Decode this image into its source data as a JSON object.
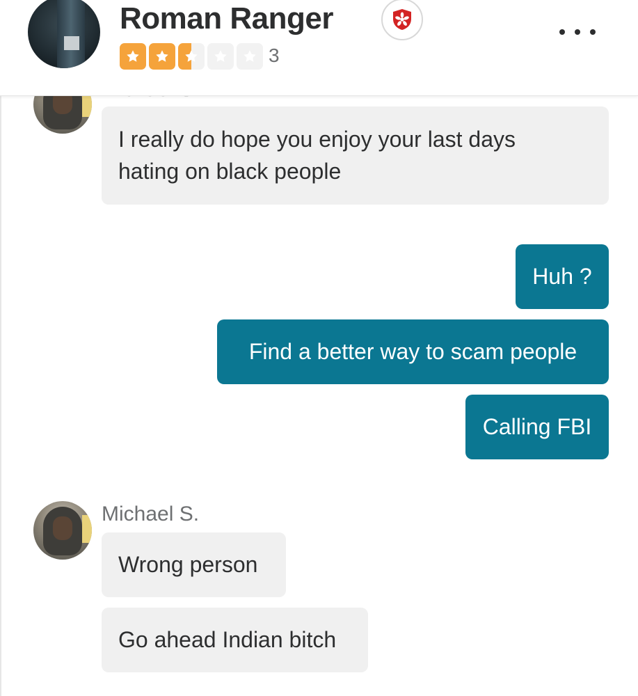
{
  "header": {
    "business_name": "Roman Ranger",
    "rating_stars": 2.5,
    "review_count": "3",
    "badge_icon": "yelp-burst-icon",
    "menu_icon": "more-horizontal-icon",
    "star_color": "#f5a33b"
  },
  "messages": [
    {
      "sender": "Michael S.",
      "direction": "incoming",
      "texts": [
        "I really do hope you enjoy your last days",
        "hating on black people"
      ]
    },
    {
      "direction": "outgoing",
      "texts": [
        "Huh ?",
        "Find a better way to scam people",
        "Calling FBI"
      ]
    },
    {
      "sender": "Michael S.",
      "direction": "incoming",
      "texts": [
        "Wrong person",
        "Go ahead Indian bitch"
      ]
    }
  ],
  "colors": {
    "outgoing_bubble": "#0b7792",
    "incoming_bubble": "#f0f0f0",
    "badge_red": "#d32323"
  }
}
